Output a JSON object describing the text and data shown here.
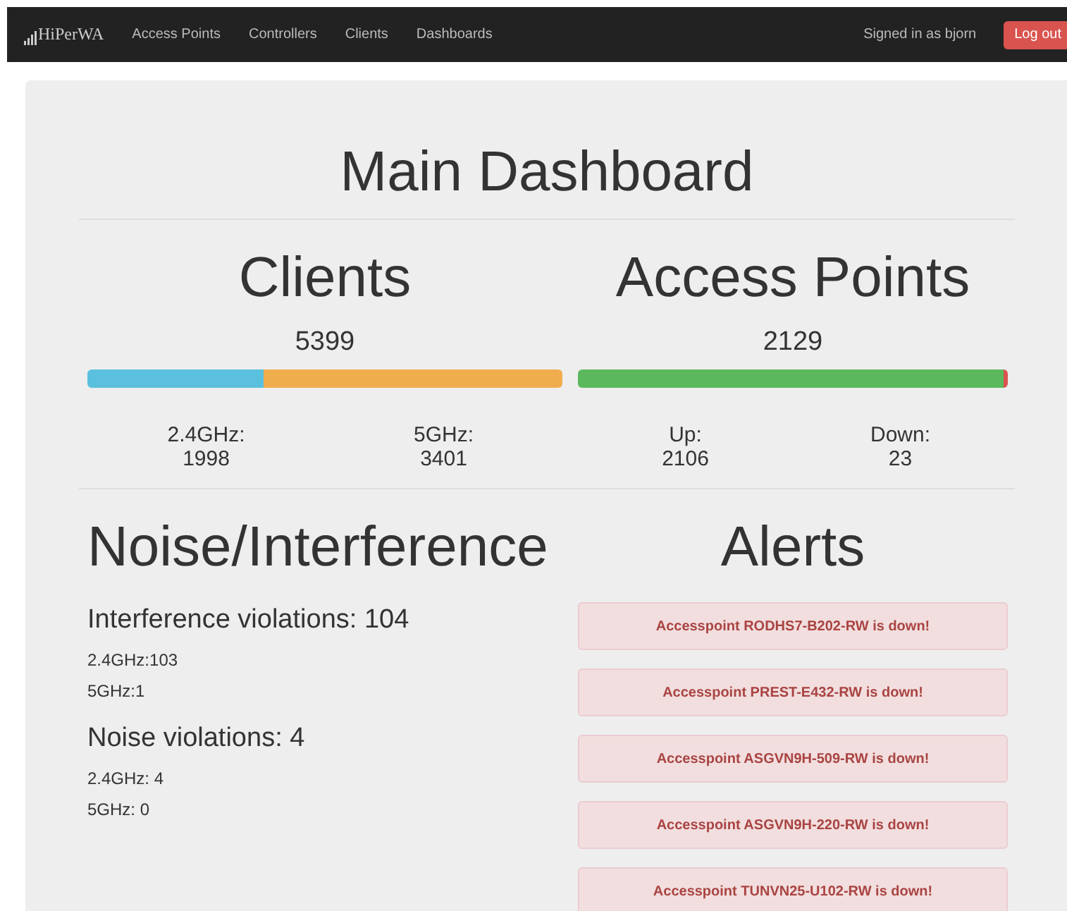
{
  "navbar": {
    "brand": "HiPerWA",
    "links": [
      "Access Points",
      "Controllers",
      "Clients",
      "Dashboards"
    ],
    "signed_in": "Signed in as bjorn",
    "logout": "Log out"
  },
  "title": "Main Dashboard",
  "summaries": [
    {
      "heading": "Clients",
      "total": "5399",
      "segments": [
        {
          "level": 0.37,
          "color": "#5bc0de"
        },
        {
          "level": 0.63,
          "color": "#f0ad4e"
        }
      ],
      "stats": [
        {
          "label": "2.4GHz:",
          "value": "1998"
        },
        {
          "label": "5GHz:",
          "value": "3401"
        }
      ]
    },
    {
      "heading": "Access Points",
      "total": "2129",
      "segments": [
        {
          "level": 0.989,
          "color": "#5cb85c"
        },
        {
          "level": 0.011,
          "color": "#d9534f"
        }
      ],
      "stats": [
        {
          "label": "Up:",
          "value": "2106"
        },
        {
          "label": "Down:",
          "value": "23"
        }
      ]
    }
  ],
  "noise": {
    "heading": "Noise/Interference",
    "groups": [
      {
        "title": "Interference violations: 104",
        "lines": [
          "2.4GHz:103",
          "5GHz:1"
        ]
      },
      {
        "title": "Noise violations: 4",
        "lines": [
          "2.4GHz: 4",
          "5GHz: 0"
        ]
      }
    ]
  },
  "alerts": {
    "heading": "Alerts",
    "items": [
      "Accesspoint RODHS7-B202-RW is down!",
      "Accesspoint PREST-E432-RW is down!",
      "Accesspoint ASGVN9H-509-RW is down!",
      "Accesspoint ASGVN9H-220-RW is down!",
      "Accesspoint TUNVN25-U102-RW is down!"
    ]
  }
}
